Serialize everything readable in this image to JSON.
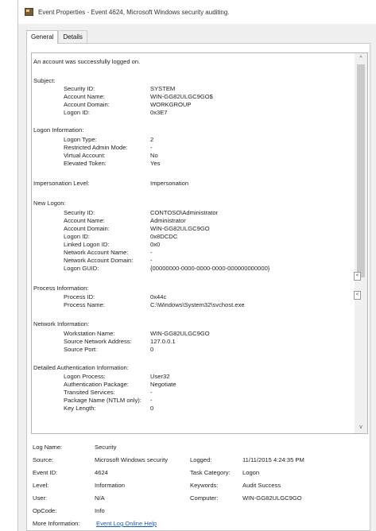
{
  "window": {
    "title": "Event Properties - Event 4624, Microsoft Windows security auditing."
  },
  "tabs": [
    {
      "label": "General",
      "active": true
    },
    {
      "label": "Details",
      "active": false
    }
  ],
  "description": {
    "summary": "An account was successfully logged on.",
    "lines": [
      {
        "label": "An account was successfully logged on.",
        "value": "",
        "indent": false
      },
      {
        "label": "Subject:",
        "value": "",
        "indent": false
      },
      {
        "label": "Security ID:",
        "value": "SYSTEM",
        "indent": true
      },
      {
        "label": "Account Name:",
        "value": "WIN-GG82ULGC9GO$",
        "indent": true
      },
      {
        "label": "Account Domain:",
        "value": "WORKGROUP",
        "indent": true
      },
      {
        "label": "Logon ID:",
        "value": "0x3E7",
        "indent": true
      },
      {
        "label": "Logon Information:",
        "value": "",
        "indent": false
      },
      {
        "label": "Logon Type:",
        "value": "2",
        "indent": true
      },
      {
        "label": "Restricted Admin Mode:",
        "value": "-",
        "indent": true
      },
      {
        "label": "Virtual Account:",
        "value": "No",
        "indent": true
      },
      {
        "label": "Elevated Token:",
        "value": "Yes",
        "indent": true
      },
      {
        "label": "Impersonation Level:",
        "value": "Impersonation",
        "indent": false
      },
      {
        "label": "New Logon:",
        "value": "",
        "indent": false
      },
      {
        "label": "Security ID:",
        "value": "CONTOSO\\Administrator",
        "indent": true
      },
      {
        "label": "Account Name:",
        "value": "Administrator",
        "indent": true
      },
      {
        "label": "Account Domain:",
        "value": "WIN-GG82ULGC9GO",
        "indent": true
      },
      {
        "label": "Logon ID:",
        "value": "0x8DCDC",
        "indent": true
      },
      {
        "label": "Linked Logon ID:",
        "value": "0x0",
        "indent": true
      },
      {
        "label": "Network Account Name:",
        "value": "-",
        "indent": true
      },
      {
        "label": "Network Account Domain:",
        "value": "-",
        "indent": true
      },
      {
        "label": "Logon GUID:",
        "value": "{00000000-0000-0000-0000-000000000000}",
        "indent": true
      },
      {
        "label": "Process Information:",
        "value": "",
        "indent": false
      },
      {
        "label": "Process ID:",
        "value": "0x44c",
        "indent": true
      },
      {
        "label": "Process Name:",
        "value": "C:\\Windows\\System32\\svchost.exe",
        "indent": true
      },
      {
        "label": "Network Information:",
        "value": "",
        "indent": false
      },
      {
        "label": "Workstation Name:",
        "value": "WIN-GG82ULGC9GO",
        "indent": true
      },
      {
        "label": "Source Network Address:",
        "value": "127.0.0.1",
        "indent": true
      },
      {
        "label": "Source Port:",
        "value": "0",
        "indent": true
      },
      {
        "label": "Detailed Authentication Information:",
        "value": "",
        "indent": false
      },
      {
        "label": "Logon Process:",
        "value": "User32",
        "indent": true
      },
      {
        "label": "Authentication Package:",
        "value": "Negotiate",
        "indent": true
      },
      {
        "label": "Transited Services:",
        "value": "-",
        "indent": true
      },
      {
        "label": "Package Name (NTLM only):",
        "value": "-",
        "indent": true
      },
      {
        "label": "Key Length:",
        "value": "0",
        "indent": true
      }
    ]
  },
  "properties": {
    "log_name": {
      "label": "Log Name:",
      "value": "Security"
    },
    "source": {
      "label": "Source:",
      "value": "Microsoft Windows security"
    },
    "logged": {
      "label": "Logged:",
      "value": "11/11/2015 4:24:35 PM"
    },
    "event_id": {
      "label": "Event ID:",
      "value": "4624"
    },
    "task_category": {
      "label": "Task Category:",
      "value": "Logon"
    },
    "level": {
      "label": "Level:",
      "value": "Information"
    },
    "keywords": {
      "label": "Keywords:",
      "value": "Audit Success"
    },
    "user": {
      "label": "User:",
      "value": "N/A"
    },
    "computer": {
      "label": "Computer:",
      "value": "WIN-GG82ULGC9GO"
    },
    "opcode": {
      "label": "OpCode:",
      "value": "Info"
    },
    "more_info": {
      "label": "More Information:",
      "link": "Event Log Online Help"
    }
  },
  "scroll_up_glyph": "^",
  "scroll_down_glyph": "v",
  "side_buttons": [
    "<",
    "<"
  ]
}
